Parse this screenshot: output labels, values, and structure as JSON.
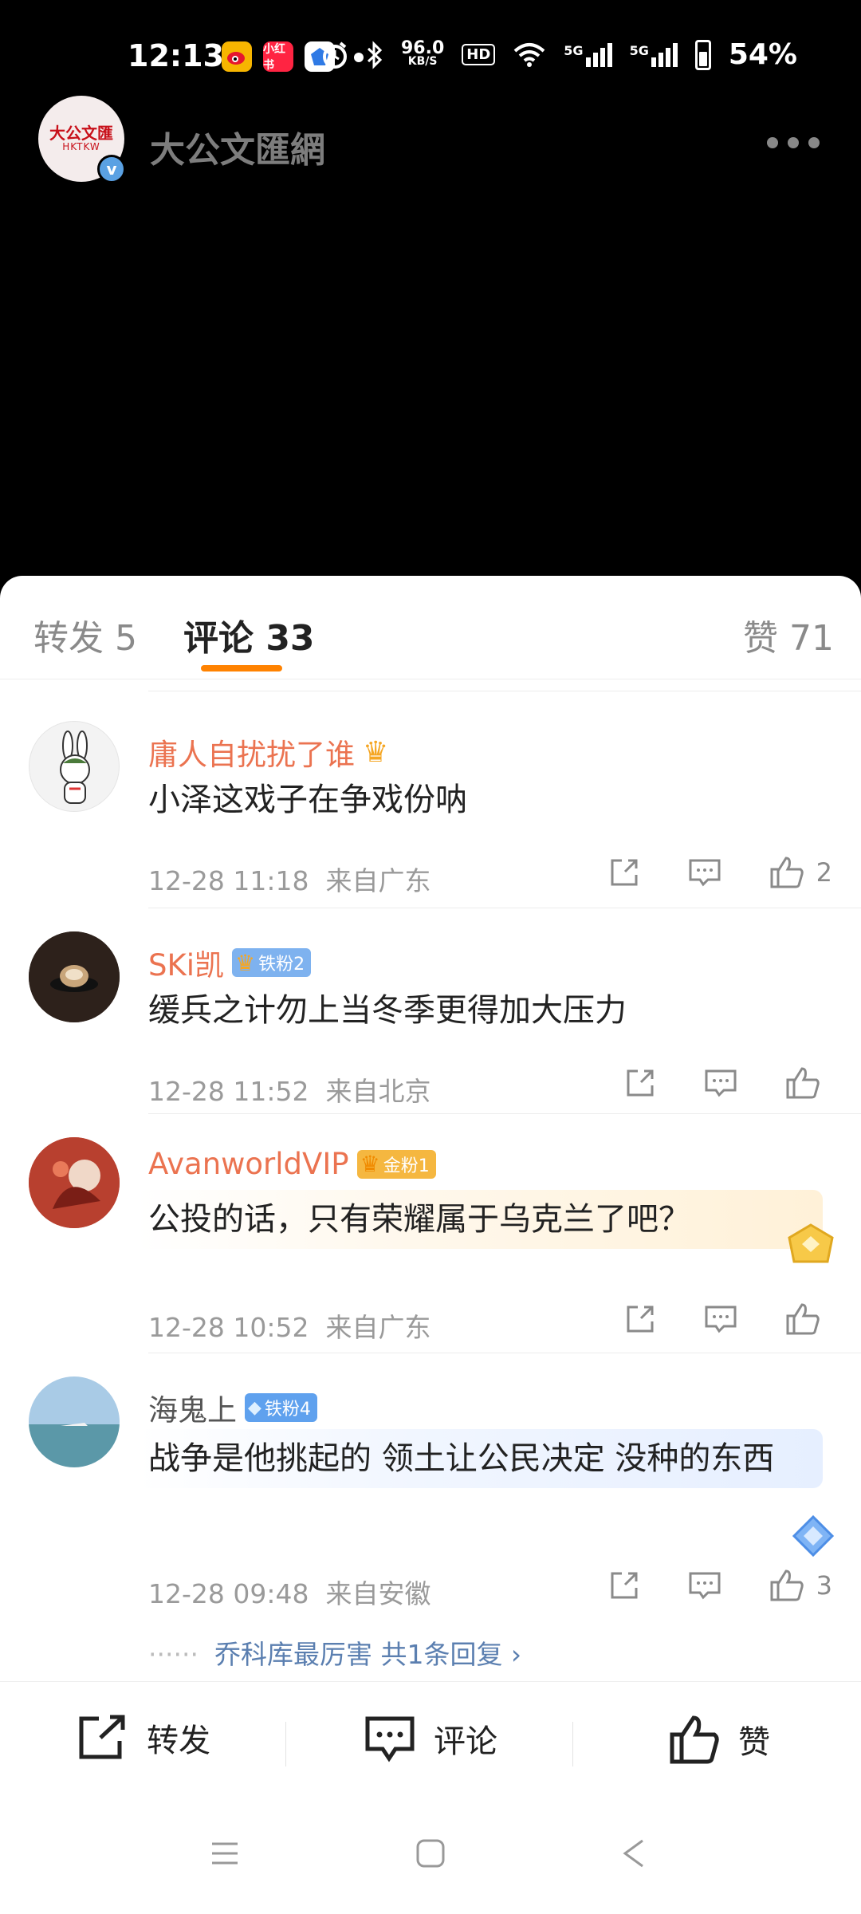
{
  "status_bar": {
    "time": "12:13",
    "app_badges": [
      {
        "name": "weibo-app-icon",
        "label": "",
        "color": "#f7b500"
      },
      {
        "name": "xiaohongshu-app-icon",
        "label": "小红书",
        "color": "#ff2442"
      },
      {
        "name": "blue-app-icon",
        "label": "",
        "color": "#2f7ae5"
      }
    ],
    "net_speed_value": "96.0",
    "net_speed_unit": "KB/S",
    "hd_label": "HD",
    "signal1_label": "5G",
    "signal2_label": "5G",
    "battery": "54%"
  },
  "profile": {
    "name": "大公文匯網",
    "logo_text": "大公文匯",
    "logo_sub": "HKTKW",
    "verified_mark": "v"
  },
  "tabs": [
    {
      "label": "转发 5"
    },
    {
      "label": "评论 33"
    },
    {
      "label": "赞 71"
    }
  ],
  "comments": [
    {
      "username": "庸人自扰扰了谁",
      "text": "小泽这戏子在争戏份呐",
      "time": "12-28 11:18",
      "location": "来自广东",
      "likes": "2"
    },
    {
      "username": "SKi凯",
      "badge": "铁粉2",
      "text": "缓兵之计勿上当冬季更得加大压力",
      "time": "12-28 11:52",
      "location": "来自北京",
      "likes": ""
    },
    {
      "username": "AvanworldVIP",
      "badge": "金粉1",
      "text": "公投的话，只有荣耀属于乌克兰了吧？",
      "time": "12-28 10:52",
      "location": "来自广东",
      "likes": ""
    },
    {
      "username": "海鬼上",
      "badge": "铁粉4",
      "text": "战争是他挑起的 领土让公民决定 没种的东西",
      "time": "12-28 09:48",
      "location": "来自安徽",
      "likes": "3",
      "reply_summary": "乔科库最厉害  共1条回复 ›"
    }
  ],
  "bottom_bar": {
    "repost": "转发",
    "comment": "评论",
    "like": "赞"
  }
}
